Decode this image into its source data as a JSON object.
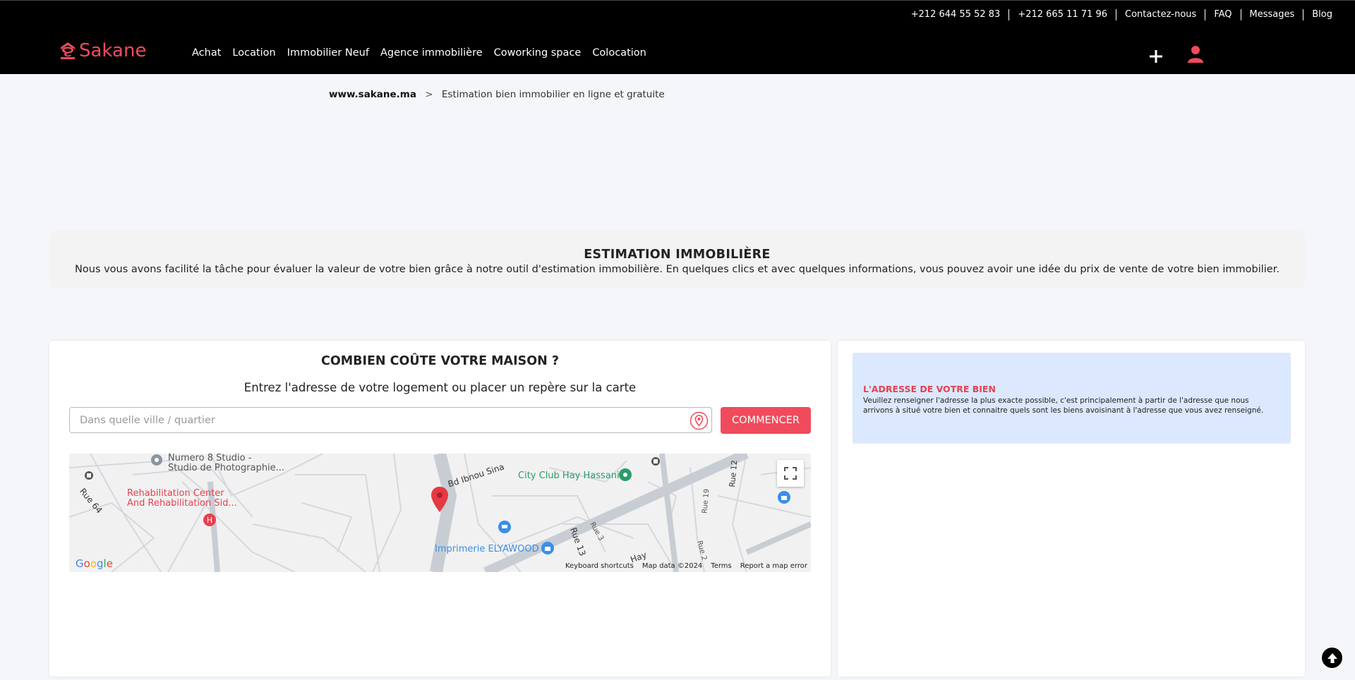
{
  "topbar": {
    "phone1": "+212 644 55 52 83",
    "phone2": "+212 665 11 71 96",
    "contact": "Contactez-nous",
    "faq": "FAQ",
    "messages": "Messages",
    "blog": "Blog"
  },
  "logo": {
    "text": "Sakane"
  },
  "nav": [
    "Achat",
    "Location",
    "Immobilier Neuf",
    "Agence immobilière",
    "Coworking space",
    "Colocation"
  ],
  "breadcrumb": {
    "home": "www.sakane.ma",
    "separator": ">",
    "current": "Estimation bien immobilier en ligne et gratuite"
  },
  "intro": {
    "title": "ESTIMATION IMMOBILIÈRE",
    "text": "Nous vous avons facilité la tâche pour évaluer la valeur de votre bien grâce à notre outil d'estimation immobilière. En quelques clics et avec quelques informations, vous pouvez avoir une idée du prix de vente de votre bien immobilier."
  },
  "estimate": {
    "title": "COMBIEN COÛTE VOTRE MAISON ?",
    "subtitle": "Entrez l'adresse de votre logement ou placer un repère sur la carte",
    "placeholder": "Dans quelle ville / quartier",
    "button": "COMMENCER"
  },
  "map": {
    "labels": {
      "studio": "Numero 8 Studio -",
      "studio2": "Studio de Photographie...",
      "rehab1": "Rehabilitation Center",
      "rehab2": "And Rehabilitation Sid...",
      "club": "City Club Hay Hassani",
      "imprimerie": "Imprimerie ELYAWOOD",
      "bd": "Bd Ibnou Sina",
      "rue64": "Rue 64",
      "rue13": "Rue 13",
      "rue3": "Rue 3",
      "rue19": "Rue 19",
      "rue12": "Rue 12",
      "rue2": "Rue 2",
      "hay": "Hay"
    },
    "google": "Google",
    "footer": [
      "Keyboard shortcuts",
      "Map data ©2024",
      "Terms",
      "Report a map error"
    ]
  },
  "address_info": {
    "title": "L'ADRESSE DE VOTRE BIEN",
    "text": "Veuillez renseigner l'adresse la plus exacte possible, c'est principalement à partir de l'adresse que nous arrivons à situé votre bien et connaitre quels sont les biens avoisinant à l'adresse que vous avez renseigné."
  },
  "colors": {
    "brand": "#f04b5c",
    "header_bg": "#000000",
    "info_bg": "#dbe8fd"
  }
}
